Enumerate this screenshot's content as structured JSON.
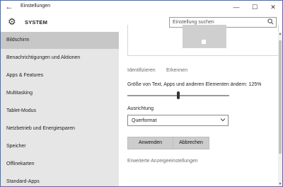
{
  "titlebar": {
    "back_icon": "back-arrow-icon",
    "title": "Einstellungen",
    "min_glyph": "—",
    "max_glyph": "☐",
    "close_glyph": "✕"
  },
  "header": {
    "app_title": "SYSTEM",
    "search_placeholder": "Einstellung suchen"
  },
  "sidebar": {
    "items": [
      {
        "label": "Bildschirm",
        "selected": true
      },
      {
        "label": "Benachrichtigungen und Aktionen"
      },
      {
        "label": "Apps & Features"
      },
      {
        "label": "Multitasking"
      },
      {
        "label": "Tablet-Modus"
      },
      {
        "label": "Netzbetrieb und Energiesparen"
      },
      {
        "label": "Speicher"
      },
      {
        "label": "Offlinekarten"
      },
      {
        "label": "Standard-Apps"
      }
    ]
  },
  "main": {
    "identify_link": "Identifizieren",
    "detect_link": "Erkennen",
    "scale_label": "Größe von Text, Apps und anderen Elementen ändern: 125%",
    "scale_position": 0.5,
    "orientation_label": "Ausrichtung",
    "orientation_value": "Querformat",
    "apply_button": "Anwenden",
    "cancel_button": "Abbrechen",
    "advanced_link": "Erweiterte Anzeigeeinstellungen"
  },
  "colors": {
    "sidebar_bg": "#e6e6e6",
    "sidebar_selected": "#c7c7c7",
    "window_border": "#3c6fd4",
    "button_bg": "#cccccc",
    "link": "#6b6b6b"
  }
}
